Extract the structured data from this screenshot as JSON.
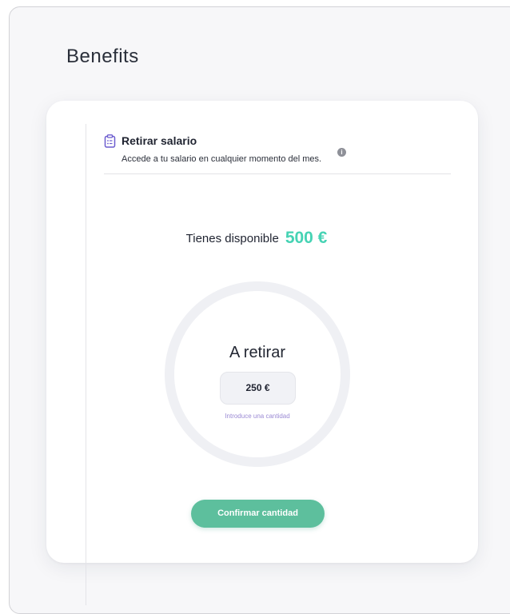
{
  "page": {
    "title": "Benefits"
  },
  "section": {
    "title": "Retirar salario",
    "subtitle": "Accede a tu salario en cualquier momento del mes.",
    "icon": "clipboard-list-icon",
    "info_icon": "info-icon"
  },
  "available": {
    "label": "Tienes disponible",
    "amount": "500 €"
  },
  "withdraw": {
    "title": "A retirar",
    "value": "250 €",
    "hint": "Introduce una cantidad"
  },
  "actions": {
    "confirm_label": "Confirmar cantidad"
  },
  "colors": {
    "accent": "#46d3b4",
    "button": "#5dbf9d",
    "hint": "#9b8ad4",
    "icon": "#6c5ccf"
  }
}
